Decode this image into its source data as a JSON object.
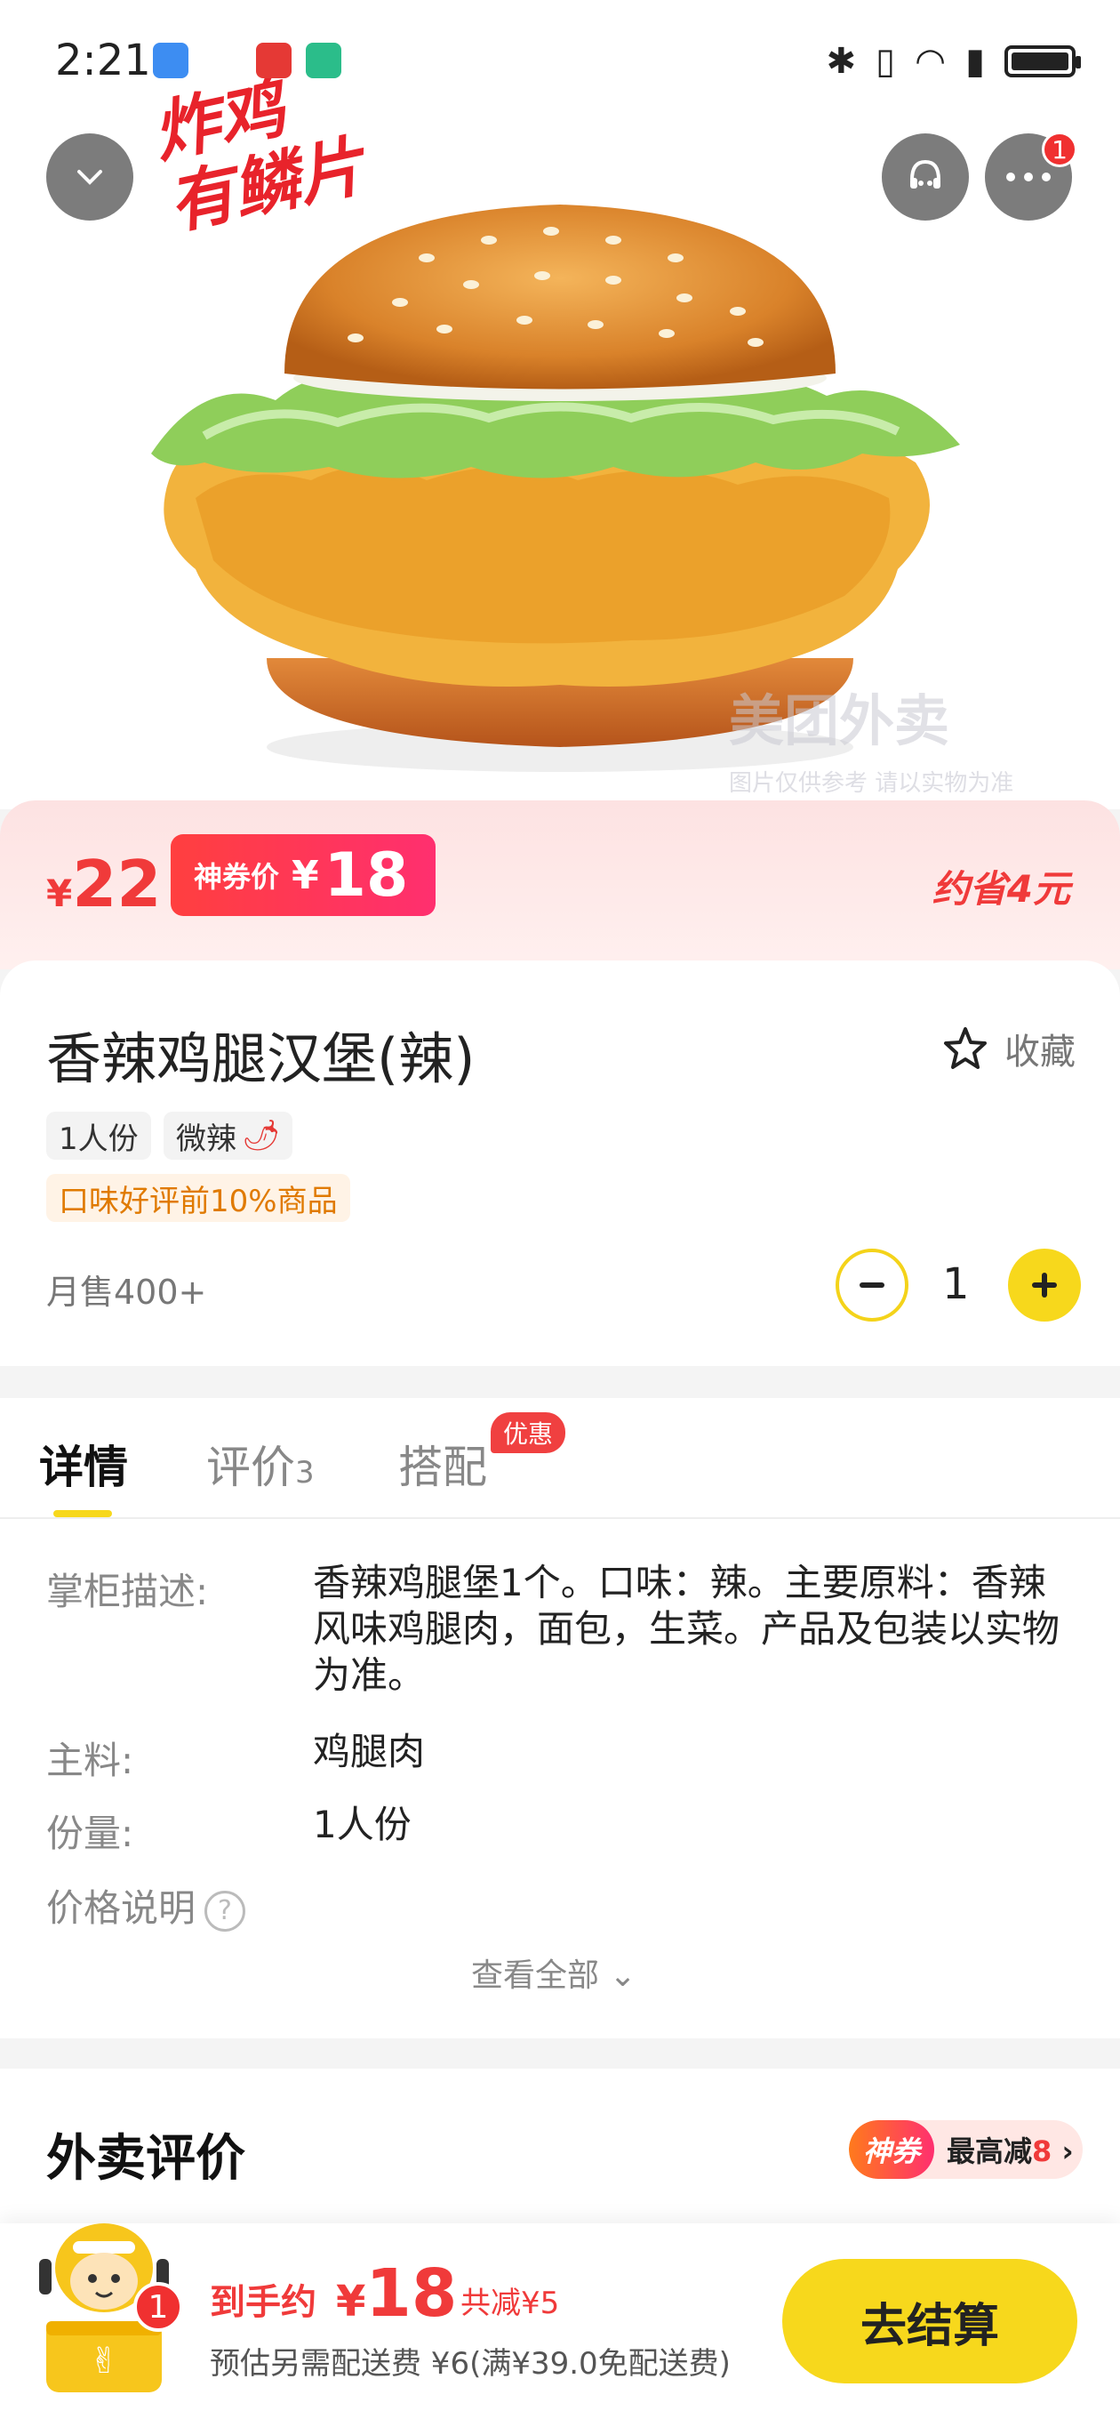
{
  "status_bar": {
    "time": "2:21",
    "notification_badge": "1"
  },
  "hero": {
    "handwriting": "有鳞片",
    "handwriting_top": "炸鸡",
    "watermark": "美团外卖",
    "watermark_sub": "图片仅供参考 请以实物为准"
  },
  "price": {
    "currency": "¥",
    "original": "22",
    "coupon_label": "神券价",
    "coupon_price": "18",
    "save_text": "约省",
    "save_amount": "4元"
  },
  "product": {
    "title": "香辣鸡腿汉堡(辣)",
    "favorite_label": "收藏",
    "tags": [
      "1人份",
      "微辣"
    ],
    "good_tag": "口味好评前10%商品",
    "monthly_sales": "月售400+",
    "quantity": "1"
  },
  "tabs": {
    "detail": "详情",
    "reviews": "评价",
    "reviews_count": "3",
    "combo": "搭配",
    "combo_badge": "优惠"
  },
  "details": {
    "desc_label": "掌柜描述:",
    "desc_value": "香辣鸡腿堡1个。口味：辣。主要原料：香辣风味鸡腿肉，面包，生菜。产品及包装以实物为准。",
    "main_label": "主料:",
    "main_value": "鸡腿肉",
    "portion_label": "份量:",
    "portion_value": "1人份",
    "price_note_label": "价格说明",
    "view_all": "查看全部"
  },
  "reviews": {
    "title": "外卖评价",
    "promo_tag": "神券",
    "promo_text": "最高减",
    "promo_amount": "8"
  },
  "bottom": {
    "cart_count": "1",
    "total_label": "到手约",
    "total_currency": "¥",
    "total_value": "18",
    "total_save": "共减¥5",
    "delivery_note": "预估另需配送费 ¥6(满¥39.0免配送费)",
    "checkout": "去结算"
  },
  "colors": {
    "accent_yellow": "#f7d81c",
    "price_red": "#f03a3a"
  },
  "icons": [
    "usb-icon",
    "huawei-icon",
    "shield-icon",
    "bluetooth-icon",
    "vibrate-icon",
    "wifi-icon",
    "battery-icon",
    "chevron-down-icon",
    "customer-service-icon",
    "more-icon",
    "star-icon",
    "chili-icon",
    "minus-icon",
    "plus-icon",
    "question-icon",
    "chevron-right-icon",
    "mascot-icon"
  ]
}
